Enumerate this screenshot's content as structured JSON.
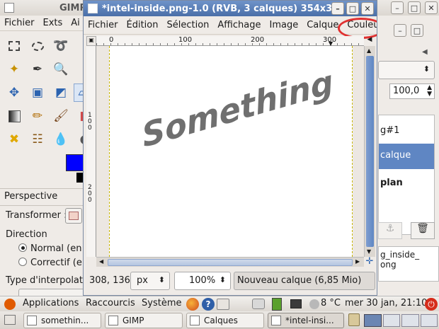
{
  "toolbox": {
    "title": "GIMP",
    "menu": [
      "Fichier",
      "Exts",
      "Ai"
    ],
    "fg_color": "#0000ff",
    "tool_options": {
      "title": "Perspective",
      "transform_label": "Transformer :",
      "direction_label": "Direction",
      "radio_normal": "Normal (en",
      "radio_corrective": "Correctif (er",
      "interpolation_label": "Type d'interpolatio"
    }
  },
  "image_window": {
    "title": "*intel-inside.png-1.0 (RVB, 3 calques) 354x3",
    "menu": [
      "Fichier",
      "Édition",
      "Sélection",
      "Affichage",
      "Image",
      "Calque",
      "Couleu"
    ],
    "ruler_marks": [
      "0",
      "100",
      "200",
      "300"
    ],
    "vruler_marks": [
      "1\n0\n0",
      "2\n0\n0"
    ],
    "canvas_text": "Something",
    "status": {
      "coords": "308, 136",
      "unit": "px",
      "zoom": "100%",
      "layer_info": "Nouveau calque (6,85 Mio)"
    }
  },
  "layers_dock": {
    "opacity": "100,0",
    "layers": [
      "g#1",
      "calque",
      "plan"
    ],
    "selected_layer": "calque",
    "bottom_text": [
      "g_inside_",
      "ong"
    ]
  },
  "top_panel": {
    "applications": "Applications",
    "places": "Raccourcis",
    "system": "Système",
    "weather": "8 °C",
    "clock": "mer 30 jan, 21:10"
  },
  "taskbar": {
    "items": [
      "somethin...",
      "GIMP",
      "Calques",
      "*intel-insi..."
    ]
  }
}
